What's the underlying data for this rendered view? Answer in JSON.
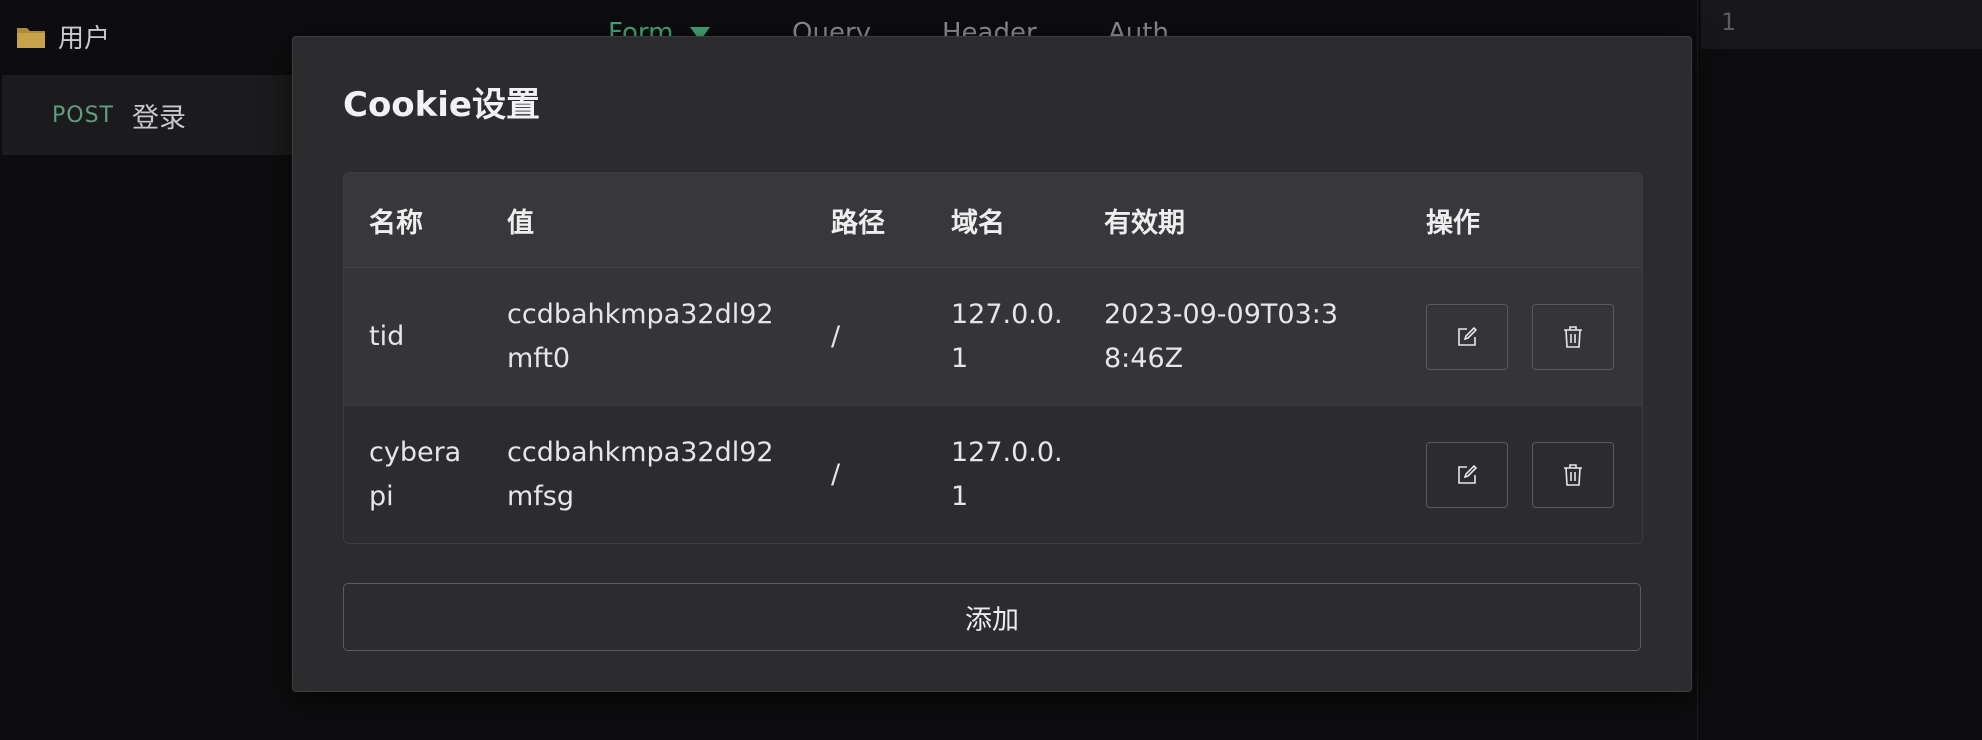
{
  "sidebar": {
    "folder_label": "用户",
    "request": {
      "method": "POST",
      "name": "登录"
    }
  },
  "tabs": [
    {
      "label": "Form"
    },
    {
      "label": "Query"
    },
    {
      "label": "Header"
    },
    {
      "label": "Auth"
    }
  ],
  "editor": {
    "line_number": "1"
  },
  "modal": {
    "title": "Cookie设置",
    "columns": {
      "name": "名称",
      "value": "值",
      "path": "路径",
      "domain": "域名",
      "expires": "有效期",
      "actions": "操作"
    },
    "rows": [
      {
        "name": "tid",
        "value": "ccdbahkmpa32dl92mft0",
        "path": "/",
        "domain": "127.0.0.1",
        "expires": "2023-09-09T03:38:46Z"
      },
      {
        "name": "cyberapi",
        "value": "ccdbahkmpa32dl92mfsg",
        "path": "/",
        "domain": "127.0.0.1",
        "expires": ""
      }
    ],
    "add_label": "添加"
  },
  "colors": {
    "accent_green": "#46a575",
    "method_green": "#5f9f7e",
    "modal_bg": "#2c2c2f",
    "header_bg": "#38383c",
    "folder_yellow": "#c8a24a"
  },
  "icons": {
    "folder": "folder-icon",
    "edit": "edit-icon",
    "delete": "trash-icon",
    "caret": "caret-down-icon"
  }
}
